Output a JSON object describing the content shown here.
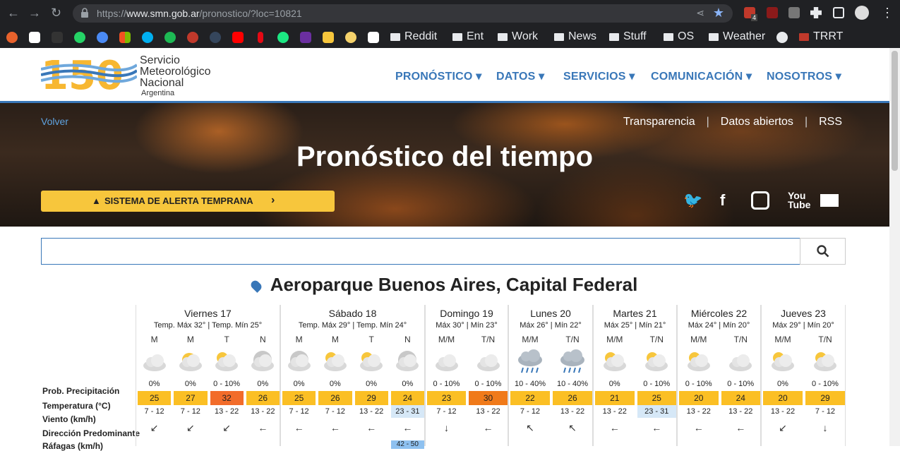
{
  "browser": {
    "url_prefix": "https://",
    "url_domain": "www.smn.gob.ar",
    "url_path": "/pronostico/?loc=10821",
    "ext_badge": "4",
    "bookmarks": [
      "Reddit",
      "Ent",
      "Work",
      "News",
      "Stuff",
      "OS",
      "Weather",
      "TRRT"
    ]
  },
  "header": {
    "logo_line1": "Servicio",
    "logo_line2": "Meteorológico",
    "logo_line3": "Nacional",
    "logo_line4": "Argentina",
    "menu": [
      "PRONÓSTICO ▾",
      "DATOS ▾",
      "SERVICIOS ▾",
      "COMUNICACIÓN ▾",
      "NOSOTROS ▾"
    ]
  },
  "hero": {
    "volver": "Volver",
    "links": [
      "Transparencia",
      "Datos abiertos",
      "RSS"
    ],
    "title": "Pronóstico del tiempo",
    "alert": "SISTEMA DE ALERTA TEMPRANA"
  },
  "search": {
    "placeholder": ""
  },
  "location": "Aeroparque Buenos Aires, Capital Federal",
  "labels": {
    "prob": "Prob. Precipitación",
    "temp": "Temperatura (°C)",
    "wind": "Viento (km/h)",
    "dir": "Dirección Predominante",
    "gust": "Ráfagas (km/h)"
  },
  "days": [
    {
      "name": "Viernes 17",
      "temps": "Temp. Máx 32° | Temp. Mín 25°",
      "periods": [
        {
          "p": "M",
          "prob": "0%",
          "temp": "25",
          "wind": "7 - 12",
          "dir": "↙",
          "icon": "cloudy"
        },
        {
          "p": "M",
          "prob": "0%",
          "temp": "27",
          "wind": "7 - 12",
          "dir": "↙",
          "icon": "sun-cloud"
        },
        {
          "p": "T",
          "prob": "0 - 10%",
          "temp": "32",
          "wind": "13 - 22",
          "dir": "↙",
          "icon": "partly-cloudy"
        },
        {
          "p": "N",
          "prob": "0%",
          "temp": "26",
          "wind": "13 - 22",
          "dir": "←",
          "icon": "night-cloudy"
        }
      ]
    },
    {
      "name": "Sábado 18",
      "temps": "Temp. Máx 29° | Temp. Mín 24°",
      "periods": [
        {
          "p": "M",
          "prob": "0%",
          "temp": "25",
          "wind": "7 - 12",
          "dir": "←",
          "icon": "night-cloudy"
        },
        {
          "p": "M",
          "prob": "0%",
          "temp": "26",
          "wind": "7 - 12",
          "dir": "←",
          "icon": "partly-cloudy"
        },
        {
          "p": "T",
          "prob": "0%",
          "temp": "29",
          "wind": "13 - 22",
          "dir": "←",
          "icon": "partly-cloudy"
        },
        {
          "p": "N",
          "prob": "0%",
          "temp": "24",
          "wind": "23 - 31",
          "dir": "←",
          "icon": "night-cloudy",
          "gust": "42 - 50"
        }
      ]
    },
    {
      "name": "Domingo 19",
      "temps": "Máx 30° | Mín 23°",
      "periods": [
        {
          "p": "M/M",
          "prob": "0 - 10%",
          "temp": "23",
          "wind": "7 - 12",
          "dir": "↓",
          "icon": "cloudy"
        },
        {
          "p": "T/N",
          "prob": "0 - 10%",
          "temp": "30",
          "wind": "13 - 22",
          "dir": "←",
          "icon": "cloudy"
        }
      ]
    },
    {
      "name": "Lunes 20",
      "temps": "Máx 26° | Mín 22°",
      "periods": [
        {
          "p": "M/M",
          "prob": "10 - 40%",
          "temp": "22",
          "wind": "7 - 12",
          "dir": "↖",
          "icon": "rain"
        },
        {
          "p": "T/N",
          "prob": "10 - 40%",
          "temp": "26",
          "wind": "13 - 22",
          "dir": "↖",
          "icon": "rain"
        }
      ]
    },
    {
      "name": "Martes 21",
      "temps": "Máx 25° | Mín 21°",
      "periods": [
        {
          "p": "M/M",
          "prob": "0%",
          "temp": "21",
          "wind": "13 - 22",
          "dir": "←",
          "icon": "partly-cloudy"
        },
        {
          "p": "T/N",
          "prob": "0 - 10%",
          "temp": "25",
          "wind": "23 - 31",
          "dir": "←",
          "icon": "partly-cloudy"
        }
      ]
    },
    {
      "name": "Miércoles 22",
      "temps": "Máx 24° | Mín 20°",
      "periods": [
        {
          "p": "M/M",
          "prob": "0 - 10%",
          "temp": "20",
          "wind": "13 - 22",
          "dir": "←",
          "icon": "partly-cloudy"
        },
        {
          "p": "T/N",
          "prob": "0 - 10%",
          "temp": "24",
          "wind": "13 - 22",
          "dir": "←",
          "icon": "cloudy"
        }
      ]
    },
    {
      "name": "Jueves 23",
      "temps": "Máx 29° | Mín 20°",
      "periods": [
        {
          "p": "M/M",
          "prob": "0%",
          "temp": "20",
          "wind": "13 - 22",
          "dir": "↙",
          "icon": "partly-cloudy"
        },
        {
          "p": "T/N",
          "prob": "0 - 10%",
          "temp": "29",
          "wind": "7 - 12",
          "dir": "↓",
          "icon": "partly-cloudy"
        }
      ]
    }
  ],
  "colors": {
    "accent": "#3977b8",
    "alert": "#f7c63c",
    "t20": "#f7c63c",
    "t24": "#f7c63c",
    "t30": "#f07a1a",
    "t32": "#f26c2a",
    "wind_light": "#ffffff",
    "wind_strong": "#d6e8f7"
  }
}
